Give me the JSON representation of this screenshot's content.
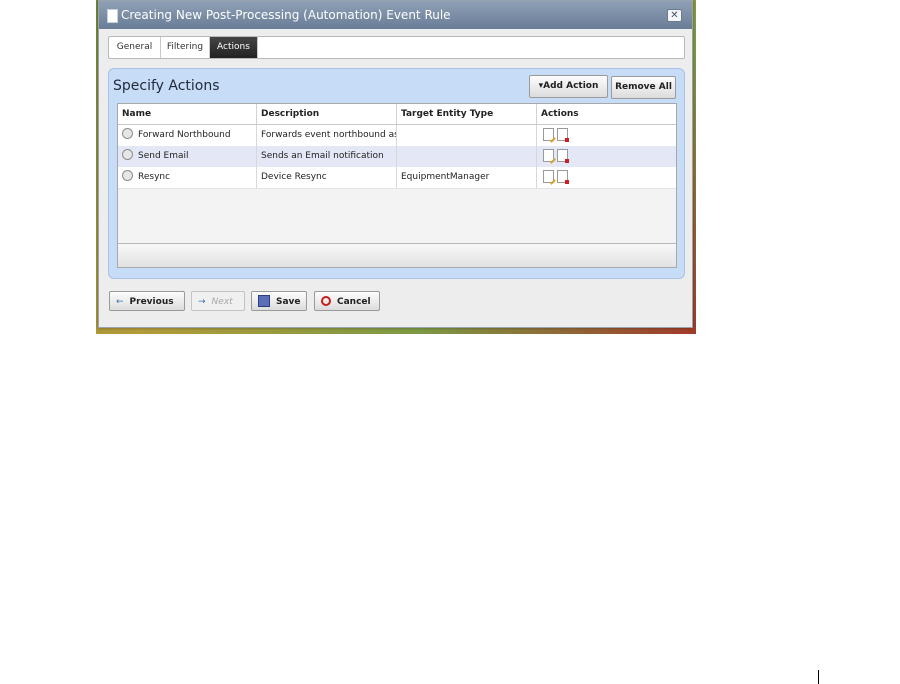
{
  "window": {
    "title": "Creating New Post-Processing (Automation) Event Rule",
    "close_glyph": "✕"
  },
  "tabs": [
    {
      "label": "General",
      "active": false
    },
    {
      "label": "Filtering",
      "active": false
    },
    {
      "label": "Actions",
      "active": true
    }
  ],
  "panel": {
    "title": "Specify Actions",
    "add_action_label": "▾Add Action",
    "remove_all_label": "Remove All"
  },
  "table": {
    "columns": [
      "Name",
      "Description",
      "Target Entity Type",
      "Actions"
    ],
    "rows": [
      {
        "name": "Forward Northbound",
        "description": "Forwards event northbound as S",
        "target": ""
      },
      {
        "name": "Send Email",
        "description": "Sends an Email notification",
        "target": ""
      },
      {
        "name": "Resync",
        "description": "Device Resync",
        "target": "EquipmentManager"
      }
    ]
  },
  "footer": {
    "previous_label": "Previous",
    "next_label": "Next",
    "save_label": "Save",
    "cancel_label": "Cancel",
    "back_arrow": "←",
    "fwd_arrow": "→"
  },
  "colors": {
    "panel_bg": "#c7dcf6",
    "active_tab": "#2b2b2b",
    "selected_row": "#e4e8f6"
  }
}
